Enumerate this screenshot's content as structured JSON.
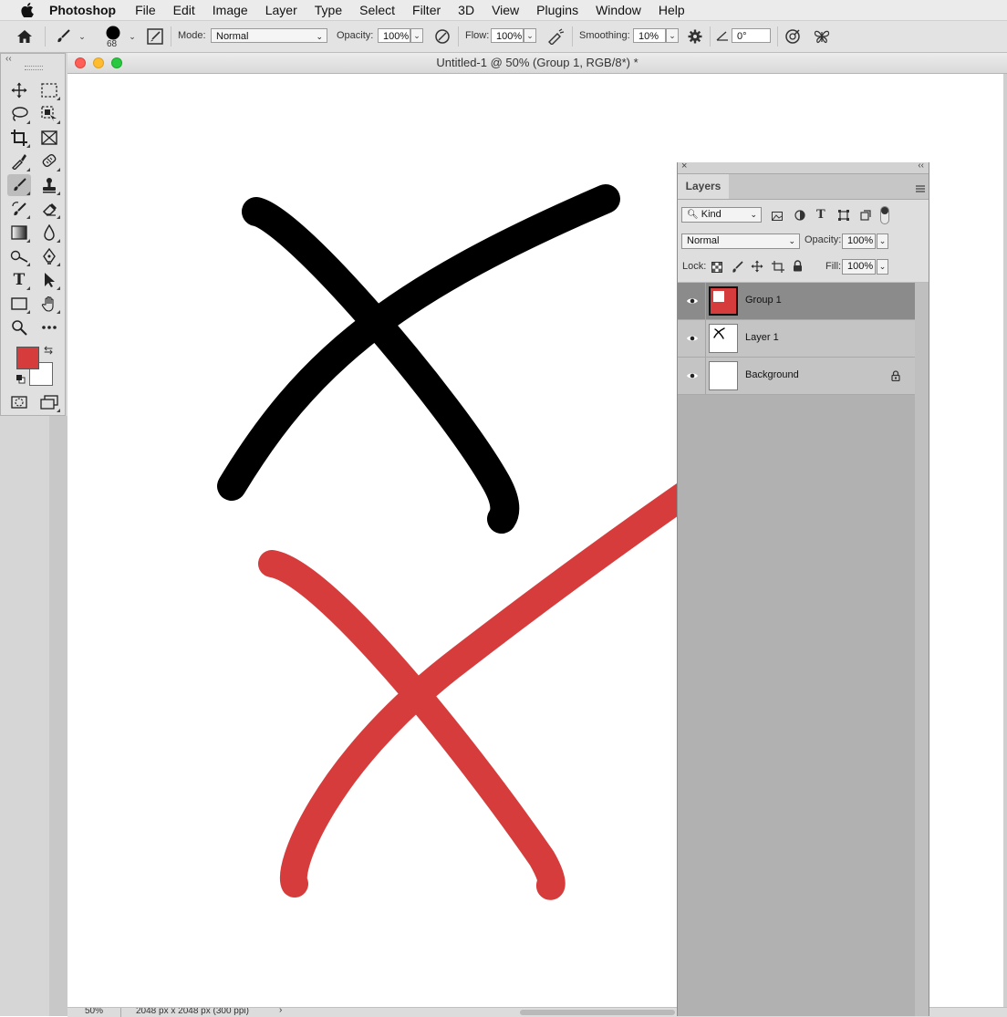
{
  "menubar": {
    "app_name": "Photoshop",
    "items": [
      "File",
      "Edit",
      "Image",
      "Layer",
      "Type",
      "Select",
      "Filter",
      "3D",
      "View",
      "Plugins",
      "Window",
      "Help"
    ]
  },
  "options_bar": {
    "brush_size": "68",
    "mode_label": "Mode:",
    "mode_value": "Normal",
    "opacity_label": "Opacity:",
    "opacity_value": "100%",
    "flow_label": "Flow:",
    "flow_value": "100%",
    "smoothing_label": "Smoothing:",
    "smoothing_value": "10%",
    "angle_value": "0°"
  },
  "document": {
    "title": "Untitled-1 @ 50% (Group 1, RGB/8*) *",
    "zoom": "50%",
    "info": "2048 px x 2048 px (300 ppi)"
  },
  "colors": {
    "foreground": "#d63c3c",
    "background": "#ffffff",
    "stroke_black": "#000000",
    "stroke_red": "#d63c3c"
  },
  "layers_panel": {
    "tab_label": "Layers",
    "filter_kind": "Kind",
    "blend_mode": "Normal",
    "opacity_label": "Opacity:",
    "opacity_value": "100%",
    "lock_label": "Lock:",
    "fill_label": "Fill:",
    "fill_value": "100%",
    "layers": [
      {
        "name": "Group 1",
        "selected": true,
        "locked": false
      },
      {
        "name": "Layer 1",
        "selected": false,
        "locked": false
      },
      {
        "name": "Background",
        "selected": false,
        "locked": true
      }
    ]
  },
  "icons": [
    "apple-icon",
    "home-icon",
    "brush-icon",
    "brush-settings-icon",
    "airbrush-icon",
    "pressure-icon",
    "gear-icon",
    "angle-icon",
    "symmetry-icon",
    "butterfly-icon",
    "eye-icon",
    "lock-icon",
    "panel-menu-icon"
  ]
}
